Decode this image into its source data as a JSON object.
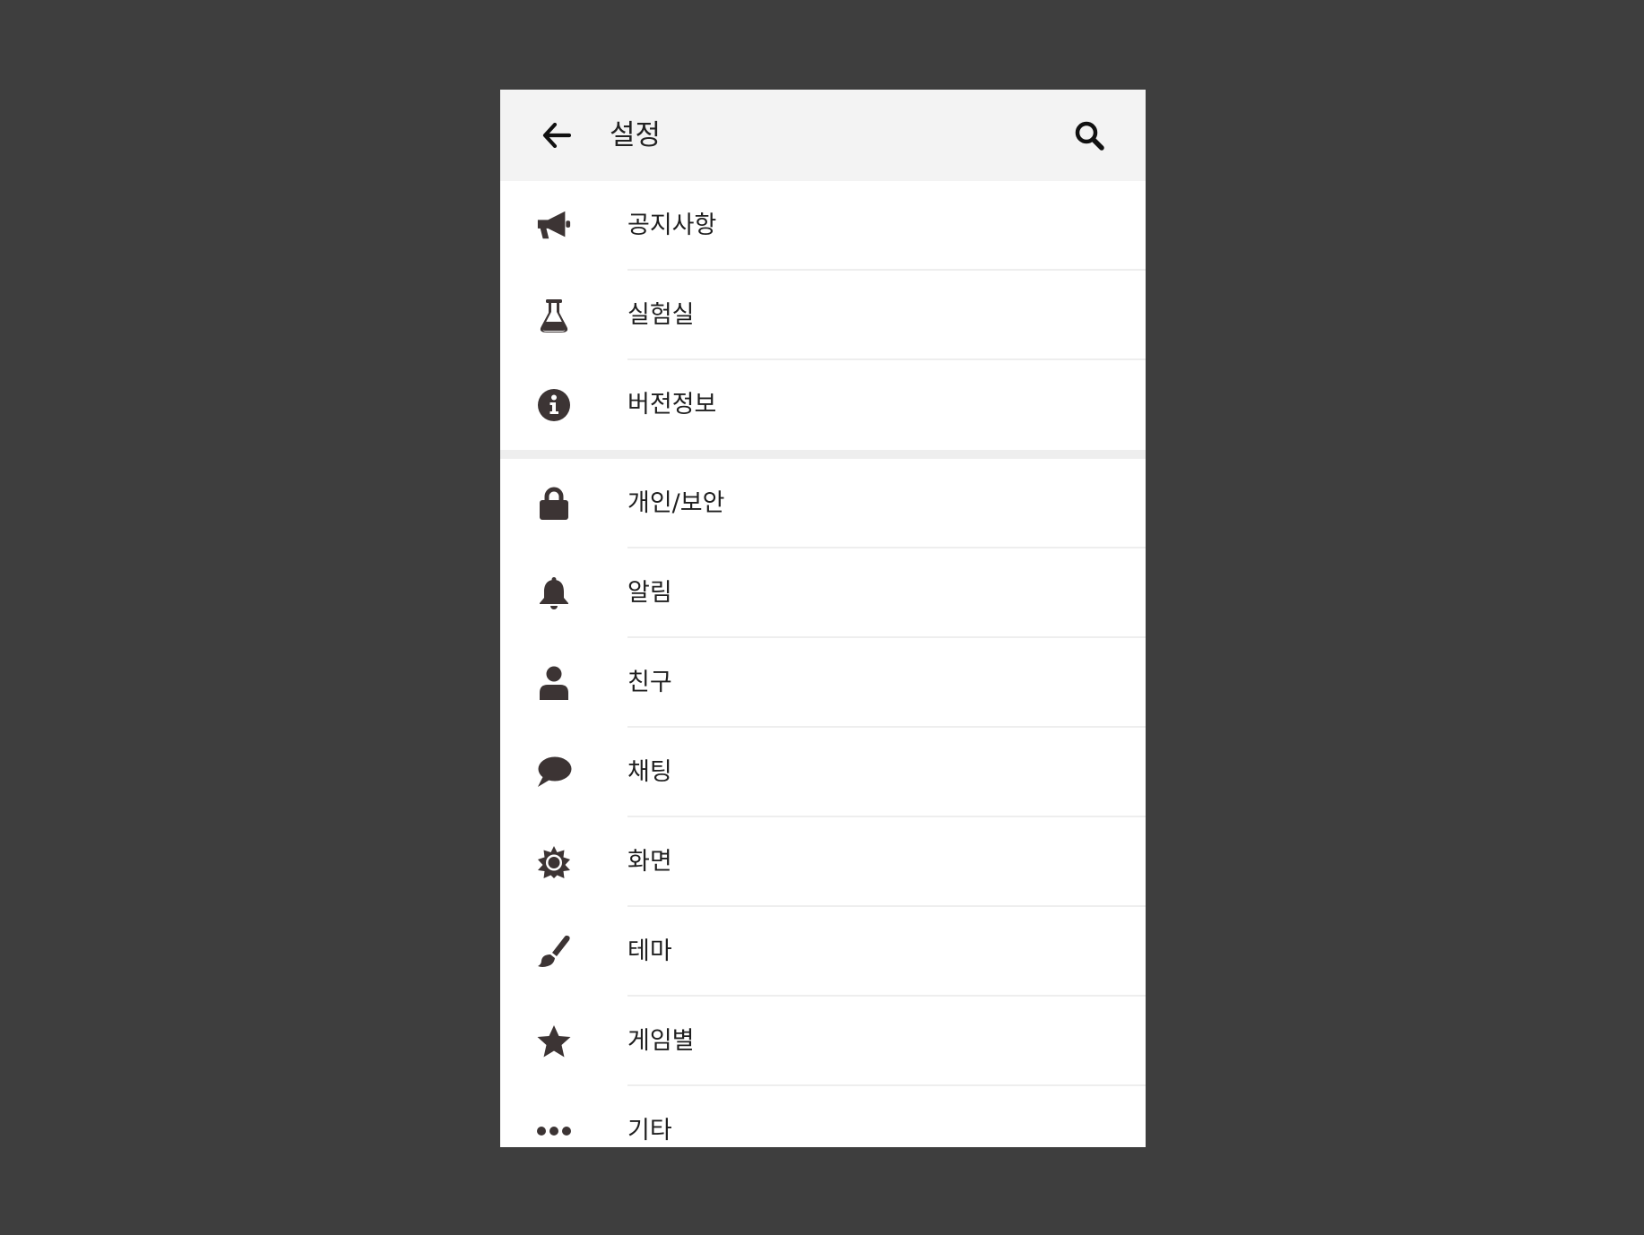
{
  "appbar": {
    "title": "설정"
  },
  "icon_color": "#3c3434",
  "sections": [
    {
      "items": [
        {
          "label": "공지사항",
          "icon": "megaphone-icon"
        },
        {
          "label": "실험실",
          "icon": "flask-icon"
        },
        {
          "label": "버전정보",
          "icon": "info-icon"
        }
      ]
    },
    {
      "items": [
        {
          "label": "개인/보안",
          "icon": "lock-icon"
        },
        {
          "label": "알림",
          "icon": "bell-icon"
        },
        {
          "label": "친구",
          "icon": "person-icon"
        },
        {
          "label": "채팅",
          "icon": "chat-bubble-icon"
        },
        {
          "label": "화면",
          "icon": "sun-icon"
        },
        {
          "label": "테마",
          "icon": "paintbrush-icon"
        },
        {
          "label": "게임별",
          "icon": "star-icon"
        },
        {
          "label": "기타",
          "icon": "more-dots-icon"
        }
      ]
    }
  ]
}
